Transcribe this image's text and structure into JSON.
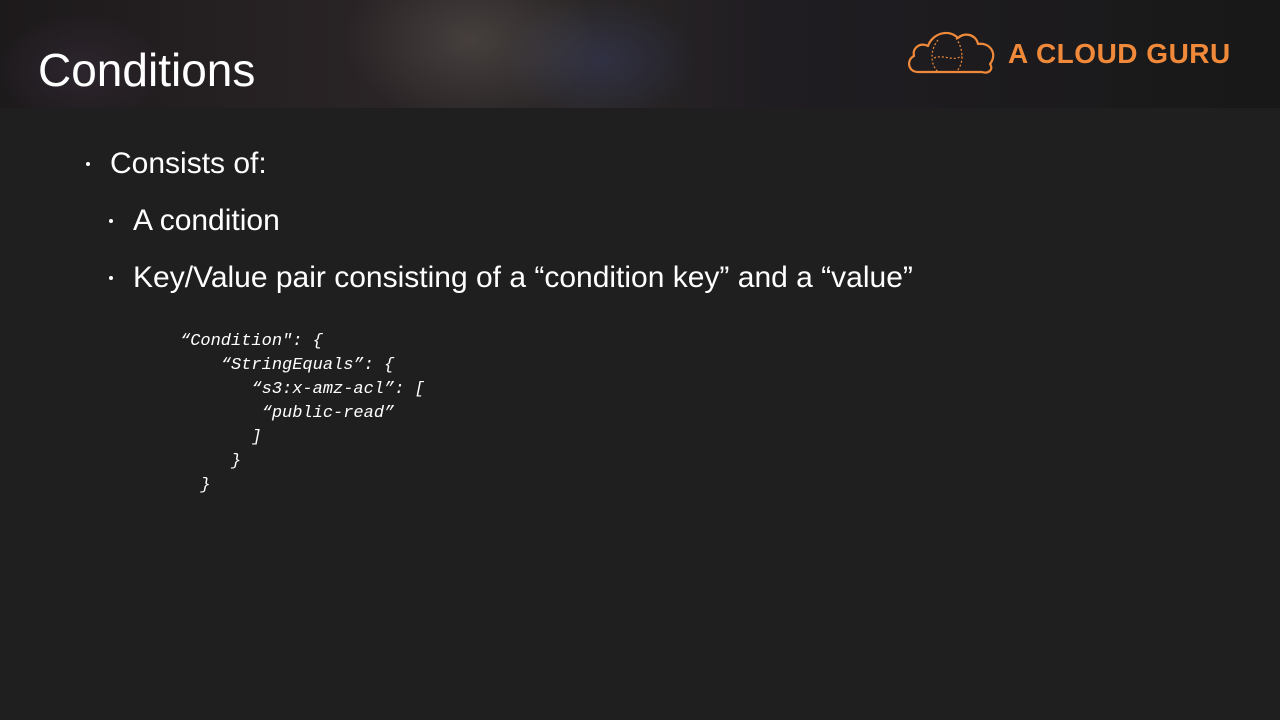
{
  "slide": {
    "title": "Conditions"
  },
  "logo": {
    "text": "A CLOUD GURU",
    "icon": "cloud-logo-icon",
    "color": "#f08a3a"
  },
  "bullets": [
    "Consists of:",
    "A condition",
    "Key/Value pair consisting of a “condition key” and a “value”"
  ],
  "code": [
    "“Condition\": {",
    "    “StringEquals”: {",
    "       “s3:x-amz-acl”: [",
    "        “public-read”",
    "       ]",
    "     }",
    "  }"
  ]
}
